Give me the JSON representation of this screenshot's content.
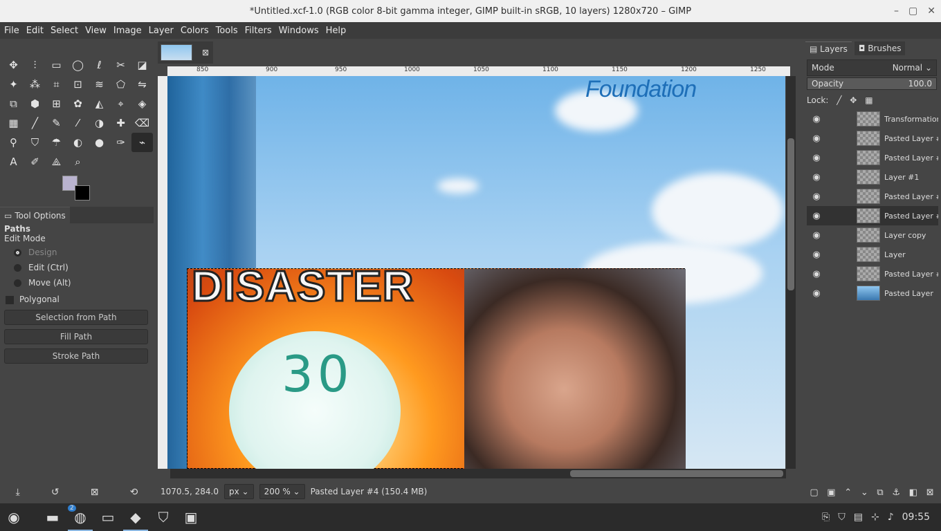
{
  "window": {
    "title": "*Untitled.xcf-1.0 (RGB color 8-bit gamma integer, GIMP built-in sRGB, 10 layers) 1280x720 – GIMP",
    "controls": [
      "–",
      "▢",
      "✕"
    ]
  },
  "menu": [
    "File",
    "Edit",
    "Select",
    "View",
    "Image",
    "Layer",
    "Colors",
    "Tools",
    "Filters",
    "Windows",
    "Help"
  ],
  "tools": [
    {
      "name": "move-icon",
      "glyph": "✥"
    },
    {
      "name": "align-icon",
      "glyph": "⫶"
    },
    {
      "name": "rect-select-icon",
      "glyph": "▭"
    },
    {
      "name": "ellipse-select-icon",
      "glyph": "◯"
    },
    {
      "name": "free-select-icon",
      "glyph": "ℓ"
    },
    {
      "name": "scissors-icon",
      "glyph": "✂"
    },
    {
      "name": "foreground-select-icon",
      "glyph": "◪"
    },
    {
      "name": "fuzzy-select-icon",
      "glyph": "✦"
    },
    {
      "name": "by-color-select-icon",
      "glyph": "⁂"
    },
    {
      "name": "crop-icon",
      "glyph": "⌗"
    },
    {
      "name": "unified-transform-icon",
      "glyph": "⊡"
    },
    {
      "name": "warp-icon",
      "glyph": "≋"
    },
    {
      "name": "cage-icon",
      "glyph": "⬠"
    },
    {
      "name": "flip-icon",
      "glyph": "⇋"
    },
    {
      "name": "perspective-icon",
      "glyph": "⧉"
    },
    {
      "name": "3d-transform-icon",
      "glyph": "⬢"
    },
    {
      "name": "handle-transform-icon",
      "glyph": "⊞"
    },
    {
      "name": "seamless-clone-icon",
      "glyph": "✿"
    },
    {
      "name": "gradient-icon",
      "glyph": "◭"
    },
    {
      "name": "mypaint-icon",
      "glyph": "⌖"
    },
    {
      "name": "bucket-fill-icon",
      "glyph": "◈"
    },
    {
      "name": "blend-icon",
      "glyph": "▦"
    },
    {
      "name": "paintbrush-icon",
      "glyph": "╱"
    },
    {
      "name": "pencil-icon",
      "glyph": "✎"
    },
    {
      "name": "airbrush-icon",
      "glyph": "⁄"
    },
    {
      "name": "ink-icon",
      "glyph": "◑"
    },
    {
      "name": "heal-icon",
      "glyph": "✚"
    },
    {
      "name": "eraser-icon",
      "glyph": "⌫"
    },
    {
      "name": "clone-icon",
      "glyph": "⚲"
    },
    {
      "name": "perspective-clone-icon",
      "glyph": "⛉"
    },
    {
      "name": "smudge-icon",
      "glyph": "☂"
    },
    {
      "name": "dodge-icon",
      "glyph": "◐"
    },
    {
      "name": "blur-icon",
      "glyph": "●"
    },
    {
      "name": "color-picker-icon",
      "glyph": "✑"
    },
    {
      "name": "paths-icon",
      "glyph": "⌁"
    },
    {
      "name": "text-icon",
      "glyph": "A"
    },
    {
      "name": "eyedropper-icon",
      "glyph": "✐"
    },
    {
      "name": "measure-icon",
      "glyph": "⟁"
    },
    {
      "name": "zoom-icon",
      "glyph": "⌕"
    }
  ],
  "colors": {
    "fg": "#b9b3cf",
    "bg": "#000000"
  },
  "tool_options": {
    "tab": "Tool Options",
    "heading": "Paths",
    "edit_mode_label": "Edit Mode",
    "modes": [
      "Design",
      "Edit (Ctrl)",
      "Move (Alt)"
    ],
    "polygonal": "Polygonal",
    "buttons": [
      "Selection from Path",
      "Fill Path",
      "Stroke Path"
    ]
  },
  "canvas": {
    "ruler_ticks": [
      "850",
      "900",
      "950",
      "1000",
      "1050",
      "1100",
      "1150",
      "1200",
      "1250"
    ],
    "logo_text": "Foundation",
    "headline": "DISASTER",
    "pill_text": "30"
  },
  "status": {
    "coords": "1070.5, 284.0",
    "unit": "px",
    "zoom": "200 %",
    "layer_info": "Pasted Layer #4 (150.4 MB)"
  },
  "right_dock": {
    "tabs": [
      "Layers",
      "Brushes"
    ],
    "mode_label": "Mode",
    "mode_value": "Normal",
    "opacity_label": "Opacity",
    "opacity_value": "100.0",
    "lock_label": "Lock:",
    "layers": [
      {
        "name": "Transformation"
      },
      {
        "name": "Pasted Layer #"
      },
      {
        "name": "Pasted Layer #"
      },
      {
        "name": "Layer #1"
      },
      {
        "name": "Pasted Layer #"
      },
      {
        "name": "Pasted Layer #"
      },
      {
        "name": "Layer copy"
      },
      {
        "name": "Layer"
      },
      {
        "name": "Pasted Layer #"
      },
      {
        "name": "Pasted Layer"
      }
    ]
  },
  "taskbar": {
    "badge": "2",
    "clock": "09:55"
  }
}
